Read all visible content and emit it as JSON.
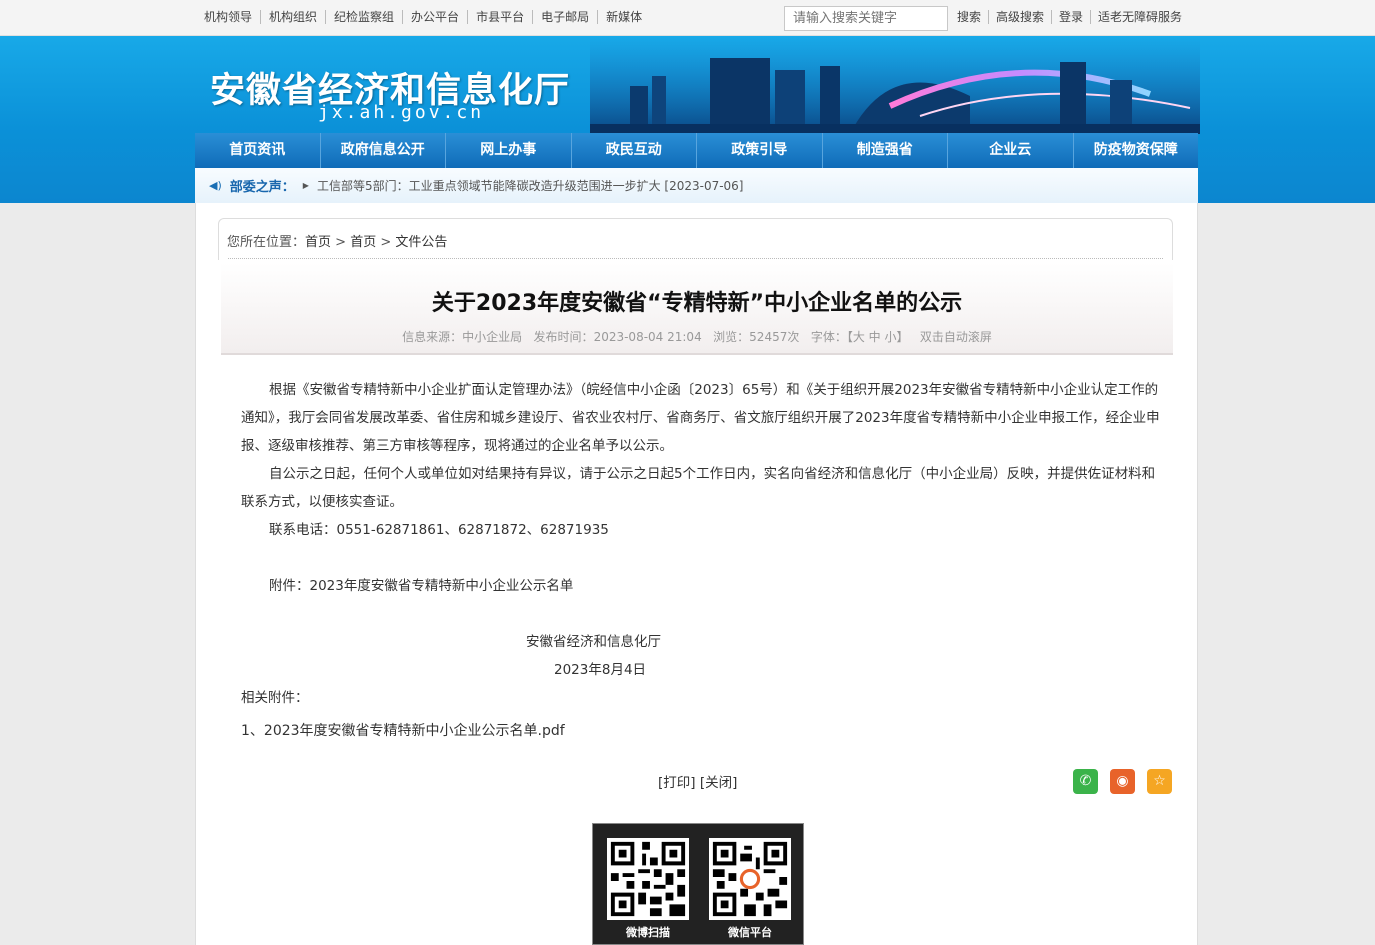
{
  "topbar": {
    "links": [
      "机构领导",
      "机构组织",
      "纪检监察组",
      "办公平台",
      "市县平台",
      "电子邮局",
      "新媒体"
    ],
    "search_placeholder": "请输入搜索关键字",
    "search_label": "搜索",
    "advanced_search": "高级搜索",
    "login": "登录",
    "accessibility": "适老无障碍服务"
  },
  "header": {
    "site_name": "安徽省经济和信息化厅",
    "domain": "jx.ah.gov.cn"
  },
  "nav": [
    "首页资讯",
    "政府信息公开",
    "网上办事",
    "政民互动",
    "政策引导",
    "制造强省",
    "企业云",
    "防疫物资保障"
  ],
  "ticker": {
    "label": "部委之声：",
    "text": "工信部等5部门：工业重点领域节能降碳改造升级范围进一步扩大 [2023-07-06]"
  },
  "breadcrumb": {
    "prefix": "您所在位置：",
    "items": [
      "首页",
      "首页",
      "文件公告"
    ]
  },
  "article": {
    "title": "关于2023年度安徽省“专精特新”中小企业名单的公示",
    "meta": {
      "source_label": "信息来源：",
      "source": "中小企业局",
      "time_label": "发布时间：",
      "time": "2023-08-04 21:04",
      "views_label": "浏览：",
      "views": "52457次",
      "font_label": "字体：",
      "font_sizes": "【大 中 小】",
      "autoscroll": "双击自动滚屏"
    },
    "p1": "根据《安徽省专精特新中小企业扩面认定管理办法》（皖经信中小企函〔2023〕65号）和《关于组织开展2023年安徽省专精特新中小企业认定工作的通知》，我厅会同省发展改革委、省住房和城乡建设厅、省农业农村厅、省商务厅、省文旅厅组织开展了2023年度省专精特新中小企业申报工作，经企业申报、逐级审核推荐、第三方审核等程序，现将通过的企业名单予以公示。",
    "p2": "自公示之日起，任何个人或单位如对结果持有异议，请于公示之日起5个工作日内，实名向省经济和信息化厅（中小企业局）反映，并提供佐证材料和联系方式，以便核实查证。",
    "p3": "联系电话：0551-62871861、62871872、62871935",
    "p4": "附件：2023年度安徽省专精特新中小企业公示名单",
    "signature": "安徽省经济和信息化厅",
    "date": "2023年8月4日",
    "related_label": "相关附件：",
    "attachment": "1、2023年度安徽省专精特新中小企业公示名单.pdf",
    "print": "[打印]",
    "close": "[关闭]"
  },
  "social": {
    "icons": [
      "wechat-icon",
      "weibo-icon",
      "favorite-icon"
    ],
    "colors": [
      "#3bb34a",
      "#e8632a",
      "#f5a623"
    ]
  },
  "qrcodes": {
    "weibo_label": "微博扫描",
    "wechat_label": "微信平台"
  }
}
